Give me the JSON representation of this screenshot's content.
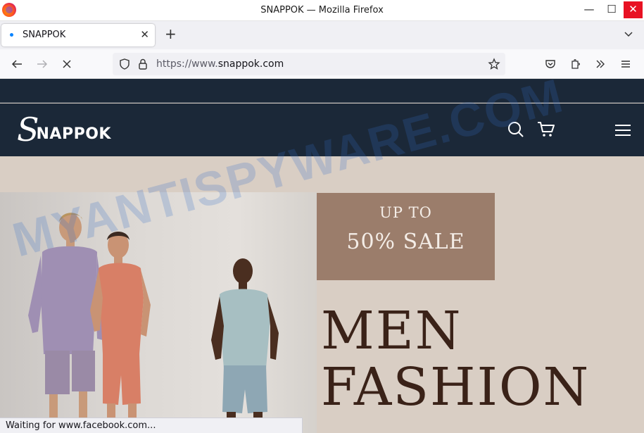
{
  "window": {
    "title": "SNAPPOK — Mozilla Firefox"
  },
  "tabs": [
    {
      "label": "SNAPPOK"
    }
  ],
  "url": {
    "scheme": "https://www.",
    "domain": "snappok.com"
  },
  "site": {
    "logo_initial": "S",
    "logo_rest": "NAPPOK",
    "sale_line1": "UP TO",
    "sale_line2": "50% SALE",
    "hero_line1": "MEN",
    "hero_line2": "FASHION"
  },
  "watermark": "MYANTISPYWARE.COM",
  "status": "Waiting for www.facebook.com...",
  "colors": {
    "header": "#1b2838",
    "sale_box": "#9b7d6b",
    "hero_bg": "#d9cec4",
    "hero_text": "#3a2218"
  }
}
